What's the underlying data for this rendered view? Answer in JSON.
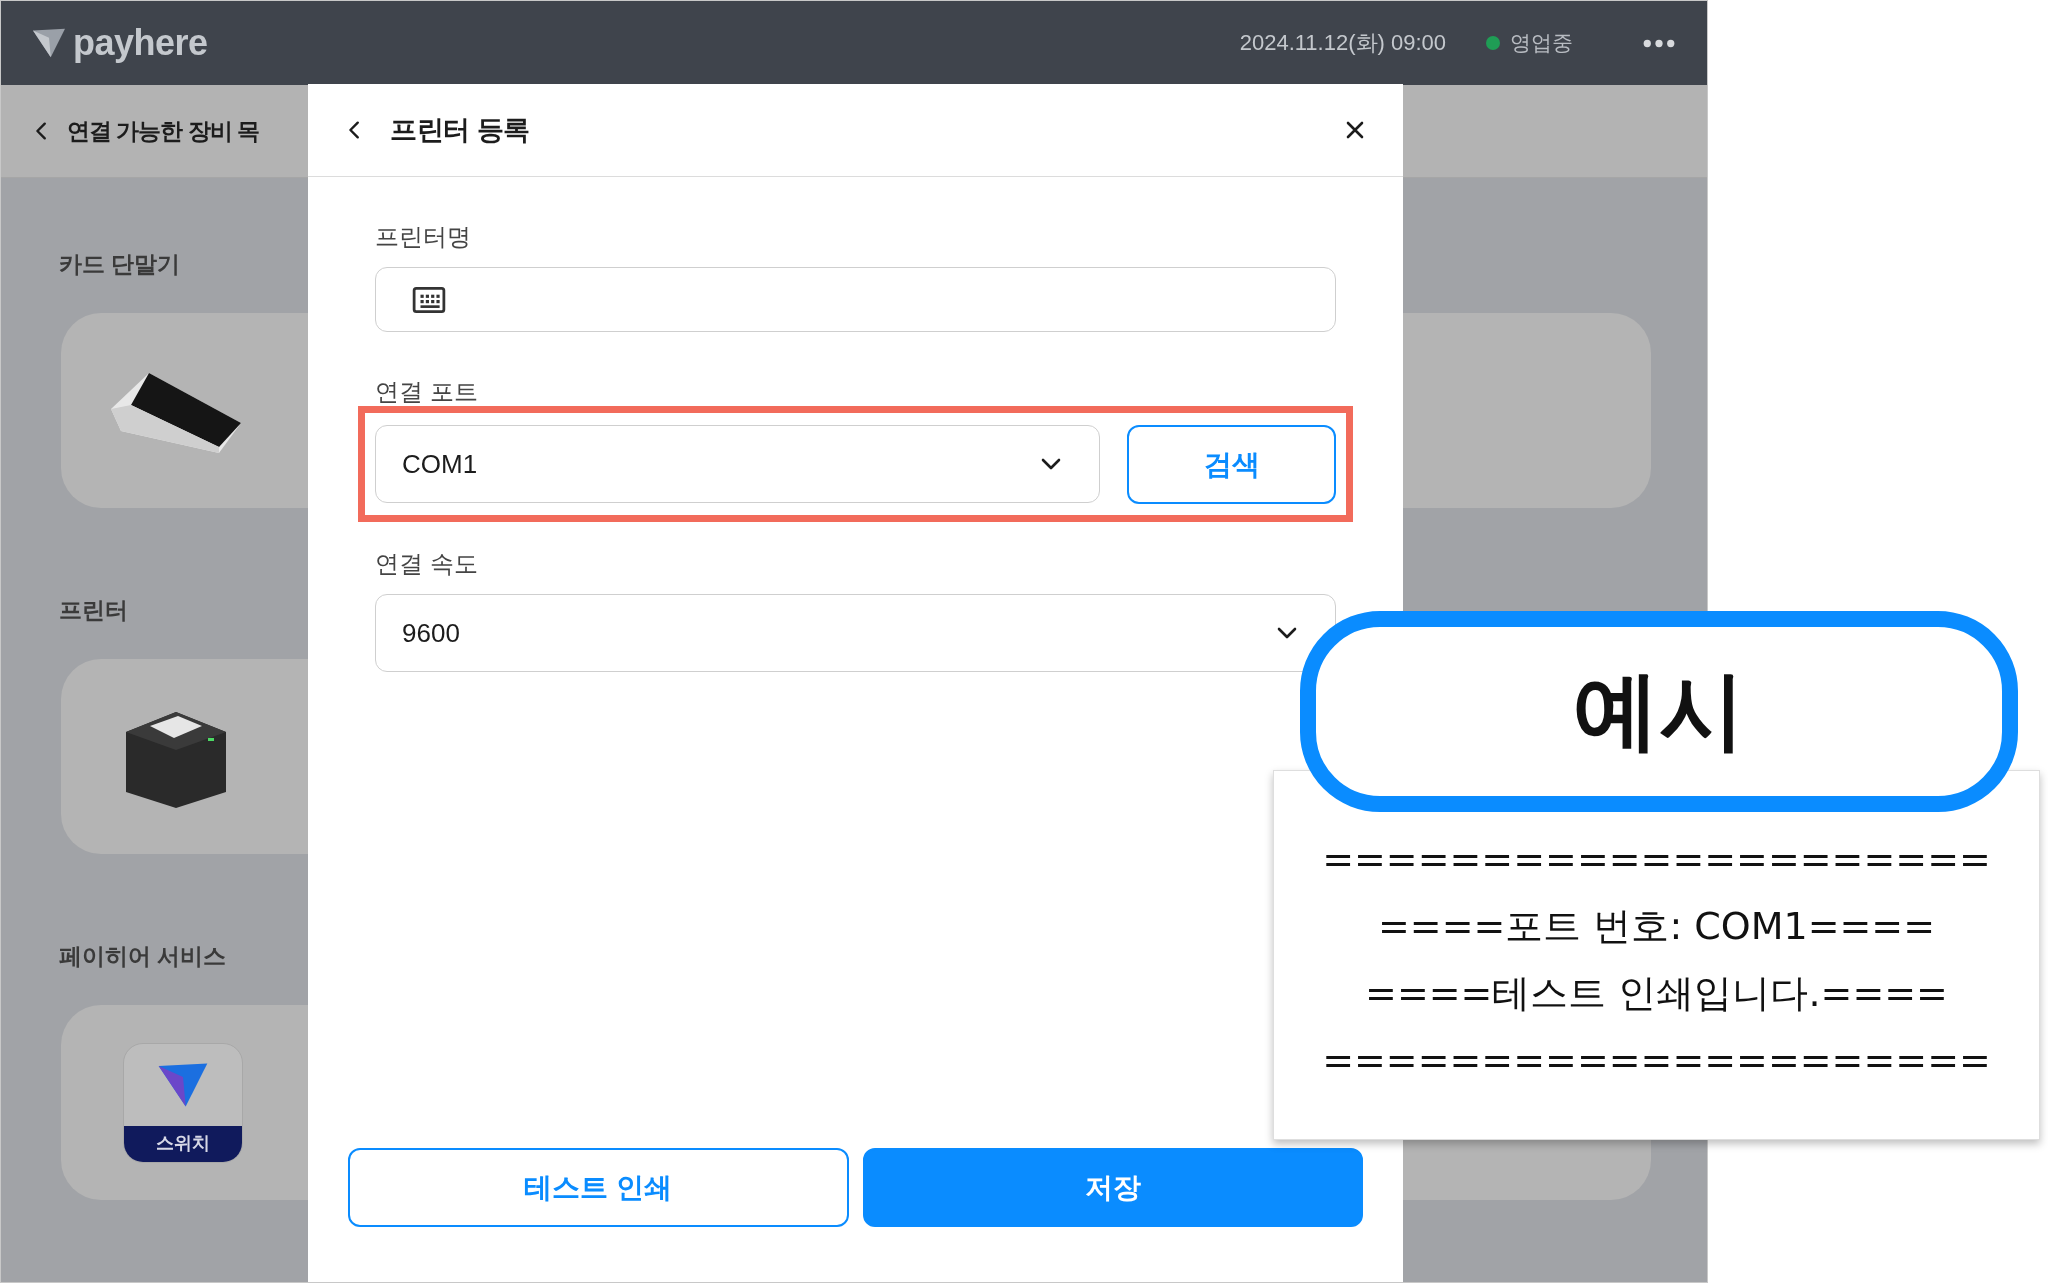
{
  "top_bar": {
    "logo": "payhere",
    "datetime": "2024.11.12(화) 09:00",
    "status": "영업중"
  },
  "background_page": {
    "title": "연결 가능한 장비 목",
    "sections": [
      {
        "title": "카드 단말기",
        "kind": "card-terminal"
      },
      {
        "title": "프린터",
        "kind": "printer"
      },
      {
        "title": "페이히어 서비스",
        "kind": "app",
        "app_label": "스위치"
      }
    ]
  },
  "modal": {
    "title": "프린터 등록",
    "fields": [
      {
        "label": "프린터명",
        "kind": "text",
        "highlighted": false
      },
      {
        "label": "연결 포트",
        "kind": "select",
        "value": "COM1",
        "button": "검색",
        "highlighted": true
      },
      {
        "label": "연결 속도",
        "kind": "select",
        "value": "9600",
        "highlighted": false
      }
    ],
    "buttons": [
      {
        "label": "테스트 인쇄",
        "kind": "secondary"
      },
      {
        "label": "저장",
        "kind": "primary"
      }
    ]
  },
  "example": {
    "title": "예시",
    "lines": [
      "=====================",
      "====포트 번호: COM1====",
      "====테스트 인쇄입니다.====",
      "====================="
    ]
  }
}
